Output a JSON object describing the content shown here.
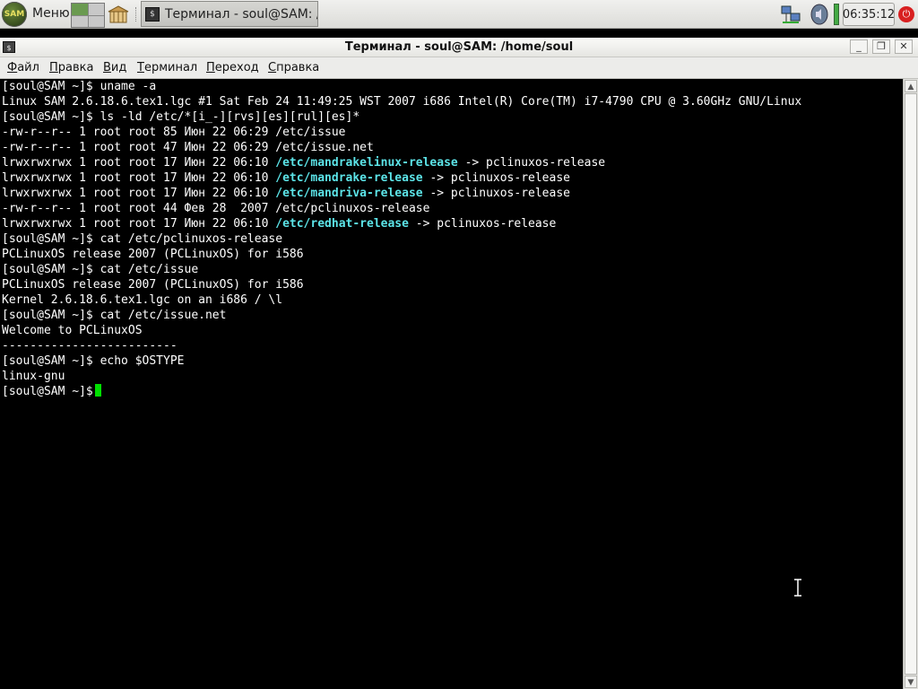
{
  "panel": {
    "logo_text": "SAM",
    "menu_label": "Меню",
    "task_button_label": "Терминал - soul@SAM: /...",
    "clock": "06:35:12",
    "colors": {
      "pager_active": "#6a9a50",
      "power": "#d82020"
    }
  },
  "window": {
    "title": "Терминал - soul@SAM: /home/soul",
    "buttons": {
      "minimize": "_",
      "maximize": "❐",
      "close": "✕"
    }
  },
  "menubar": {
    "items": [
      "Файл",
      "Правка",
      "Вид",
      "Терминал",
      "Переход",
      "Справка"
    ]
  },
  "terminal": {
    "colors": {
      "background": "#000000",
      "text": "#ffffff",
      "link": "#5ce4e8",
      "cursor": "#00e000"
    },
    "lines": [
      {
        "text": "[soul@SAM ~]$ uname -a"
      },
      {
        "text": "Linux SAM 2.6.18.6.tex1.lgc #1 Sat Feb 24 11:49:25 WST 2007 i686 Intel(R) Core(TM) i7-4790 CPU @ 3.60GHz GNU/Linux"
      },
      {
        "text": "[soul@SAM ~]$ ls -ld /etc/*[i_-][rvs][es][rul][es]*"
      },
      {
        "text": "-rw-r--r-- 1 root root 85 Июн 22 06:29 /etc/issue"
      },
      {
        "text": "-rw-r--r-- 1 root root 47 Июн 22 06:29 /etc/issue.net"
      },
      {
        "pre": "lrwxrwxrwx 1 root root 17 Июн 22 06:10 ",
        "link": "/etc/mandrakelinux-release",
        "post": " -> pclinuxos-release"
      },
      {
        "pre": "lrwxrwxrwx 1 root root 17 Июн 22 06:10 ",
        "link": "/etc/mandrake-release",
        "post": " -> pclinuxos-release"
      },
      {
        "pre": "lrwxrwxrwx 1 root root 17 Июн 22 06:10 ",
        "link": "/etc/mandriva-release",
        "post": " -> pclinuxos-release"
      },
      {
        "text": "-rw-r--r-- 1 root root 44 Фев 28  2007 /etc/pclinuxos-release"
      },
      {
        "pre": "lrwxrwxrwx 1 root root 17 Июн 22 06:10 ",
        "link": "/etc/redhat-release",
        "post": " -> pclinuxos-release"
      },
      {
        "text": "[soul@SAM ~]$ cat /etc/pclinuxos-release"
      },
      {
        "text": "PCLinuxOS release 2007 (PCLinuxOS) for i586"
      },
      {
        "text": "[soul@SAM ~]$ cat /etc/issue"
      },
      {
        "text": "PCLinuxOS release 2007 (PCLinuxOS) for i586"
      },
      {
        "text": "Kernel 2.6.18.6.tex1.lgc on an i686 / \\l"
      },
      {
        "text": "[soul@SAM ~]$ cat /etc/issue.net"
      },
      {
        "text": "Welcome to PCLinuxOS"
      },
      {
        "text": "-------------------------"
      },
      {
        "text": "[soul@SAM ~]$ echo $OSTYPE"
      },
      {
        "text": "linux-gnu"
      },
      {
        "text": "[soul@SAM ~]$",
        "cursor": true
      }
    ]
  }
}
